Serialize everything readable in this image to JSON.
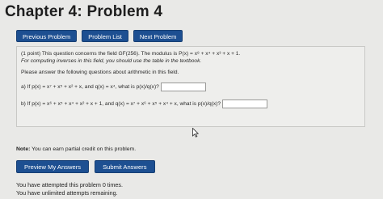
{
  "page": {
    "title": "Chapter 4: Problem 4"
  },
  "nav": {
    "previous_label": "Previous Problem",
    "list_label": "Problem List",
    "next_label": "Next Problem"
  },
  "problem": {
    "points_text": "(1 point) This question concerns the field GF(256). The modulus is P(x) = x⁸ + x⁴ + x³ + x + 1.",
    "table_note": "For computing inverses in this field, you should use the table in the textbook.",
    "instructions": "Please answer the following questions about arithmetic in this field.",
    "part_a": "a) If p(x) = x⁷ + x⁵ + x² + x, and q(x) = x⁴, what is p(x)/q(x)?",
    "part_b": "b) If p(x) = x⁶ + x⁵ + x⁴ + x² + x + 1, and q(x) = x⁷ + x⁶ + x⁵ + x⁴ + x, what is p(x)/q(x)?",
    "answer_a": "",
    "answer_b": ""
  },
  "note": {
    "label": "Note:",
    "text": " You can earn partial credit on this problem."
  },
  "actions": {
    "preview_label": "Preview My Answers",
    "submit_label": "Submit Answers"
  },
  "status": {
    "attempts": "You have attempted this problem 0 times.",
    "unlimited": "You have unlimited attempts remaining."
  },
  "colors": {
    "button": "#1d4f91",
    "background": "#e9e9e7"
  },
  "icons": [
    "mouse-pointer-icon"
  ]
}
